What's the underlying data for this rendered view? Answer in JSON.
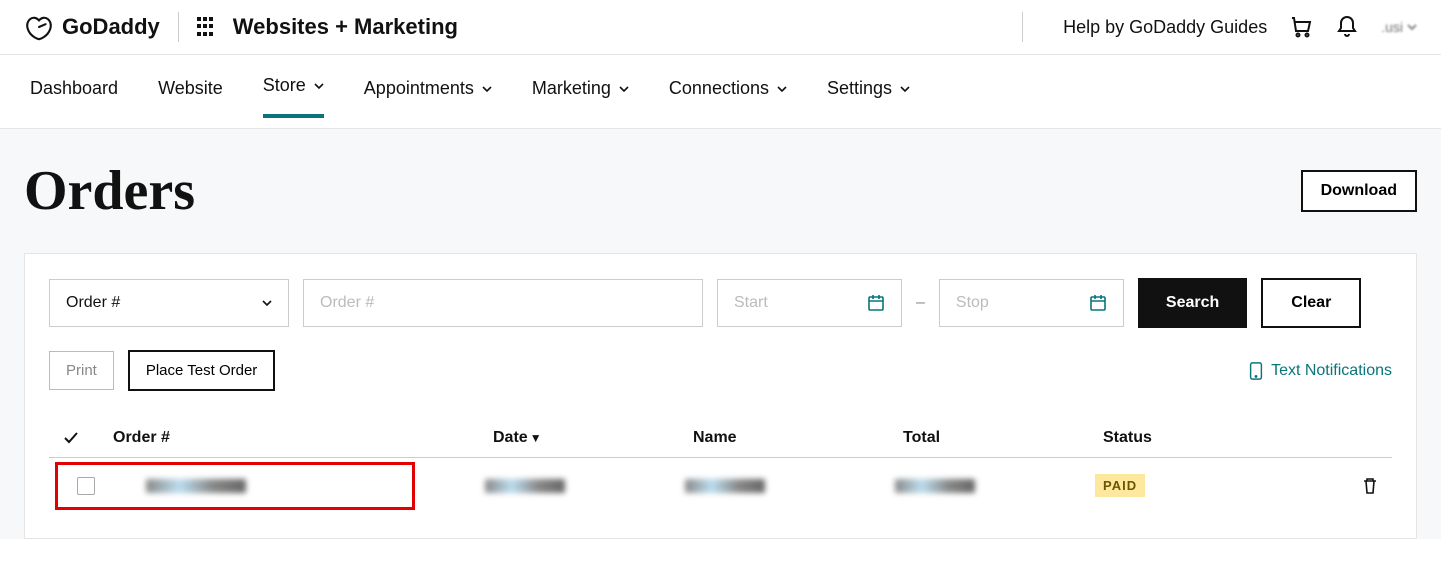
{
  "header": {
    "brand": "GoDaddy",
    "product": "Websites + Marketing",
    "help_link": "Help by GoDaddy Guides"
  },
  "nav": {
    "items": [
      {
        "label": "Dashboard",
        "dropdown": false,
        "active": false
      },
      {
        "label": "Website",
        "dropdown": false,
        "active": false
      },
      {
        "label": "Store",
        "dropdown": true,
        "active": true
      },
      {
        "label": "Appointments",
        "dropdown": true,
        "active": false
      },
      {
        "label": "Marketing",
        "dropdown": true,
        "active": false
      },
      {
        "label": "Connections",
        "dropdown": true,
        "active": false
      },
      {
        "label": "Settings",
        "dropdown": true,
        "active": false
      }
    ]
  },
  "page": {
    "title": "Orders",
    "download_label": "Download"
  },
  "filters": {
    "select_value": "Order #",
    "search_placeholder": "Order #",
    "start_placeholder": "Start",
    "stop_placeholder": "Stop",
    "search_label": "Search",
    "clear_label": "Clear"
  },
  "actions": {
    "print_label": "Print",
    "test_order_label": "Place Test Order",
    "text_notifications_label": "Text Notifications"
  },
  "table": {
    "columns": {
      "order": "Order #",
      "date": "Date",
      "name": "Name",
      "total": "Total",
      "status": "Status"
    },
    "rows": [
      {
        "order": "██████",
        "date": "██████",
        "name": "██████",
        "total": "██████",
        "status": "PAID"
      }
    ]
  }
}
